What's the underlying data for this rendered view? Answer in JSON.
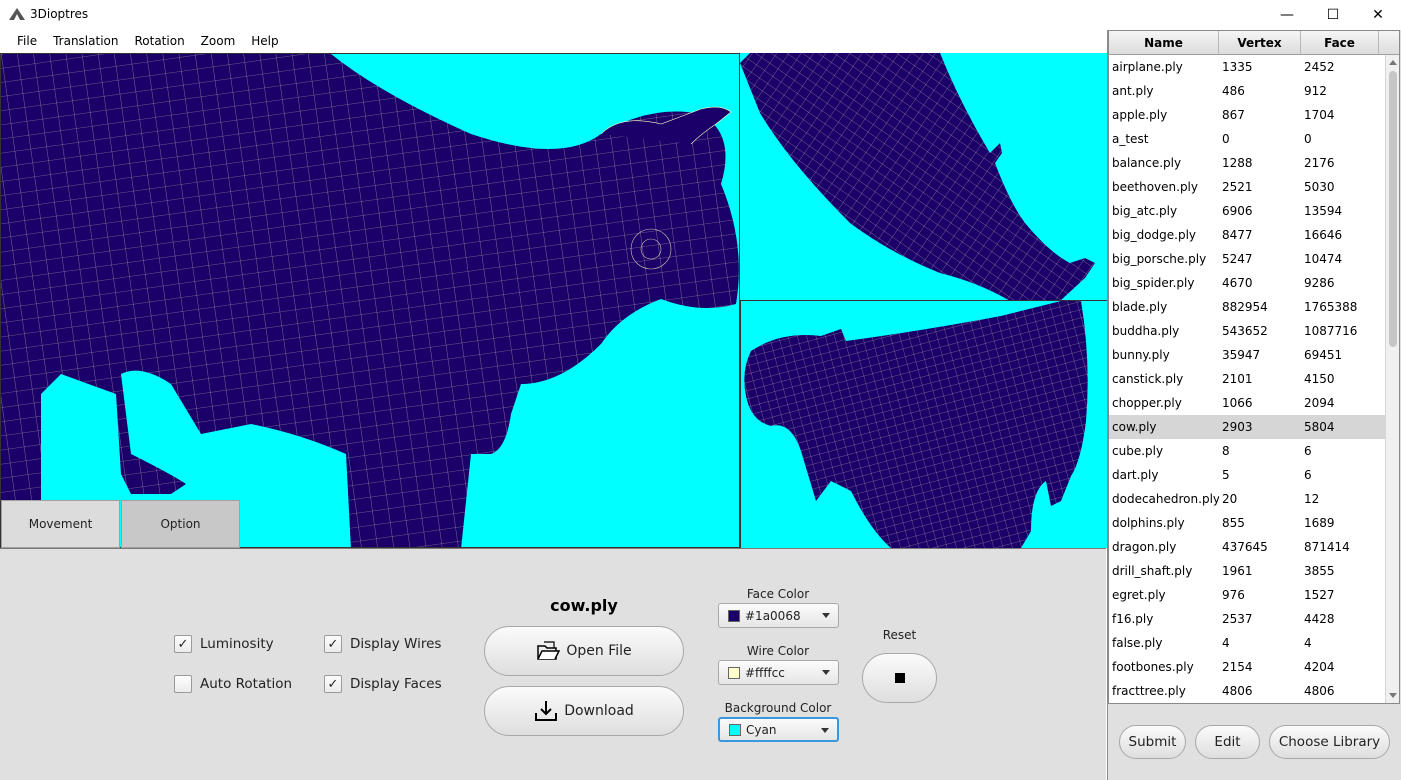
{
  "window": {
    "title": "3Dioptres",
    "minimize": "—",
    "maximize": "☐",
    "close": "✕"
  },
  "menu": [
    "File",
    "Translation",
    "Rotation",
    "Zoom",
    "Help"
  ],
  "tabs": {
    "movement": "Movement",
    "option": "Option"
  },
  "options": {
    "luminosity": {
      "label": "Luminosity",
      "checked": true
    },
    "auto_rotation": {
      "label": "Auto Rotation",
      "checked": false
    },
    "display_wires": {
      "label": "Display Wires",
      "checked": true
    },
    "display_faces": {
      "label": "Display Faces",
      "checked": true
    }
  },
  "file": {
    "name": "cow.ply",
    "open_label": "Open File",
    "download_label": "Download"
  },
  "colors": {
    "face": {
      "label": "Face Color",
      "value": "#1a0068",
      "swatch": "#1a0068"
    },
    "wire": {
      "label": "Wire Color",
      "value": "#ffffcc",
      "swatch": "#ffffcc"
    },
    "background": {
      "label": "Background Color",
      "value": "Cyan",
      "swatch": "#00ffff"
    }
  },
  "reset": {
    "label": "Reset"
  },
  "table": {
    "headers": [
      "Name",
      "Vertex",
      "Face"
    ],
    "rows": [
      [
        "airplane.ply",
        "1335",
        "2452"
      ],
      [
        "ant.ply",
        "486",
        "912"
      ],
      [
        "apple.ply",
        "867",
        "1704"
      ],
      [
        "a_test",
        "0",
        "0"
      ],
      [
        "balance.ply",
        "1288",
        "2176"
      ],
      [
        "beethoven.ply",
        "2521",
        "5030"
      ],
      [
        "big_atc.ply",
        "6906",
        "13594"
      ],
      [
        "big_dodge.ply",
        "8477",
        "16646"
      ],
      [
        "big_porsche.ply",
        "5247",
        "10474"
      ],
      [
        "big_spider.ply",
        "4670",
        "9286"
      ],
      [
        "blade.ply",
        "882954",
        "1765388"
      ],
      [
        "buddha.ply",
        "543652",
        "1087716"
      ],
      [
        "bunny.ply",
        "35947",
        "69451"
      ],
      [
        "canstick.ply",
        "2101",
        "4150"
      ],
      [
        "chopper.ply",
        "1066",
        "2094"
      ],
      [
        "cow.ply",
        "2903",
        "5804"
      ],
      [
        "cube.ply",
        "8",
        "6"
      ],
      [
        "dart.ply",
        "5",
        "6"
      ],
      [
        "dodecahedron.ply",
        "20",
        "12"
      ],
      [
        "dolphins.ply",
        "855",
        "1689"
      ],
      [
        "dragon.ply",
        "437645",
        "871414"
      ],
      [
        "drill_shaft.ply",
        "1961",
        "3855"
      ],
      [
        "egret.ply",
        "976",
        "1527"
      ],
      [
        "f16.ply",
        "2537",
        "4428"
      ],
      [
        "false.ply",
        "4",
        "4"
      ],
      [
        "footbones.ply",
        "2154",
        "4204"
      ],
      [
        "fracttree.ply",
        "4806",
        "4806"
      ]
    ],
    "selected_index": 15
  },
  "buttons": {
    "submit": "Submit",
    "edit": "Edit",
    "choose_library": "Choose Library"
  },
  "theme": {
    "viewport_bg": "#00ffff",
    "mesh_face": "#1a0068",
    "mesh_wire": "#ffffcc"
  }
}
